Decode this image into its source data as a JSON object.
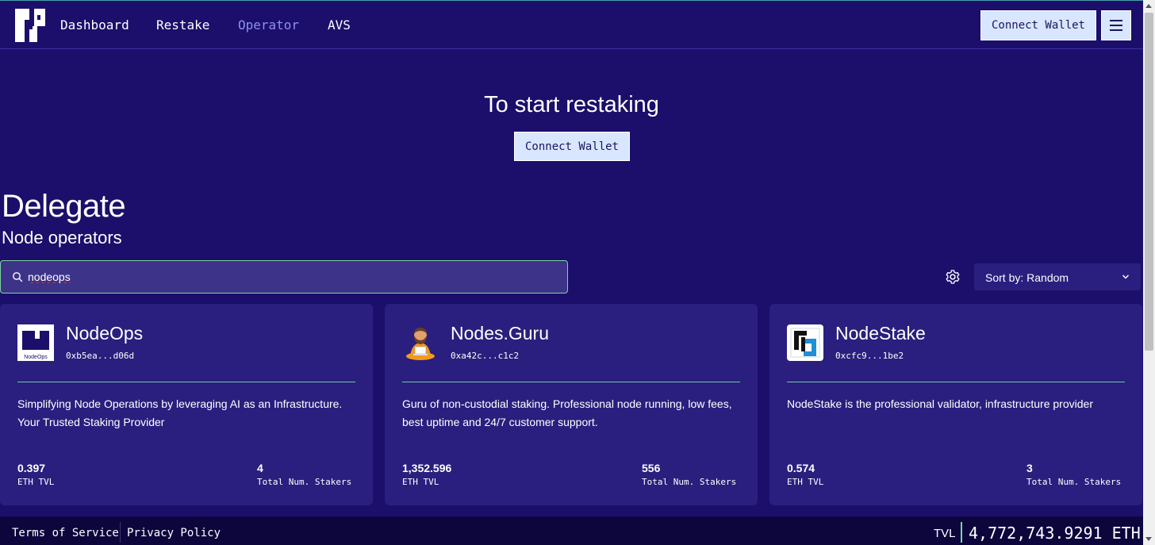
{
  "nav": {
    "links": [
      "Dashboard",
      "Restake",
      "Operator",
      "AVS"
    ],
    "active": "Operator",
    "connect_wallet": "Connect Wallet"
  },
  "hero": {
    "title": "To start restaking",
    "connect_wallet": "Connect Wallet"
  },
  "section": {
    "title": "Delegate",
    "subtitle": "Node operators"
  },
  "search": {
    "value": "nodeops"
  },
  "sort": {
    "label": "Sort by: Random"
  },
  "operators": [
    {
      "name": "NodeOps",
      "address": "0xb5ea...d06d",
      "description": "Simplifying Node Operations by leveraging AI as an Infrastructure. Your Trusted Staking Provider",
      "tvl": "0.397",
      "tvl_label": "ETH TVL",
      "stakers": "4",
      "stakers_label": "Total Num. Stakers",
      "logo_text": "NodeOps"
    },
    {
      "name": "Nodes.Guru",
      "address": "0xa42c...c1c2",
      "description": "Guru of non-custodial staking. Professional node running, low fees, best uptime and 24/7 customer support.",
      "tvl": "1,352.596",
      "tvl_label": "ETH TVL",
      "stakers": "556",
      "stakers_label": "Total Num. Stakers"
    },
    {
      "name": "NodeStake",
      "address": "0xcfc9...1be2",
      "description": "NodeStake is the professional validator, infrastructure provider",
      "tvl": "0.574",
      "tvl_label": "ETH TVL",
      "stakers": "3",
      "stakers_label": "Total Num. Stakers"
    }
  ],
  "footer": {
    "terms": "Terms of Service",
    "privacy": "Privacy Policy",
    "tvl_label": "TVL",
    "tvl_value": "4,772,743.9291 ETH"
  },
  "colors": {
    "background": "#1b0f6b",
    "card": "#2a1f7e",
    "accent_green": "#7fd4a0",
    "active_link": "#8f8ff2",
    "button": "#d8e6ff"
  }
}
